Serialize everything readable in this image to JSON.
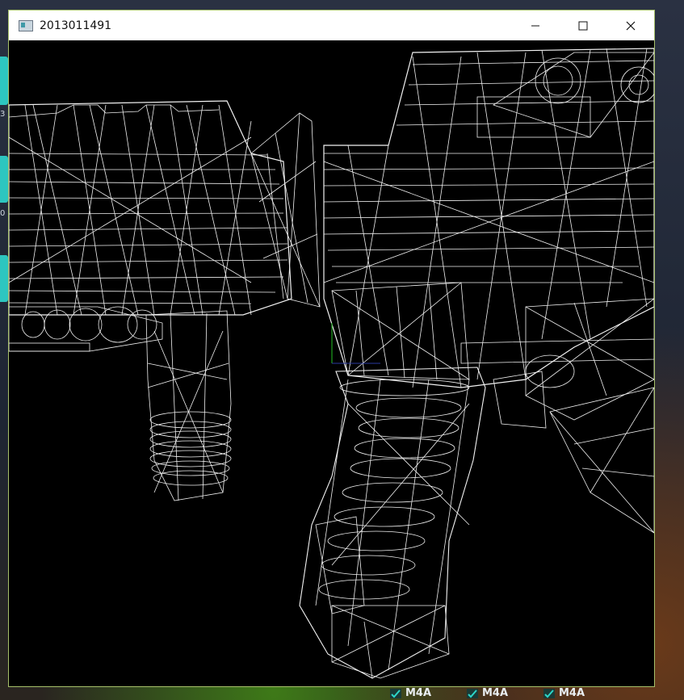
{
  "window": {
    "title": "2013011491"
  },
  "desktop": {
    "left_labels": [
      "3",
      "0"
    ],
    "taskbar_items": [
      {
        "label": "M4A"
      },
      {
        "label": "M4A"
      },
      {
        "label": "M4A"
      }
    ]
  },
  "icons": {
    "app": "app-window-icon",
    "minimize": "minimize-icon",
    "maximize": "maximize-icon",
    "close": "close-icon",
    "taskbar": "checkmark-file-icon"
  },
  "colors": {
    "window_border": "#a6c06a",
    "viewport_background": "#000000",
    "wireframe": "#ffffff",
    "accent_tab": "#2dc6c0"
  }
}
